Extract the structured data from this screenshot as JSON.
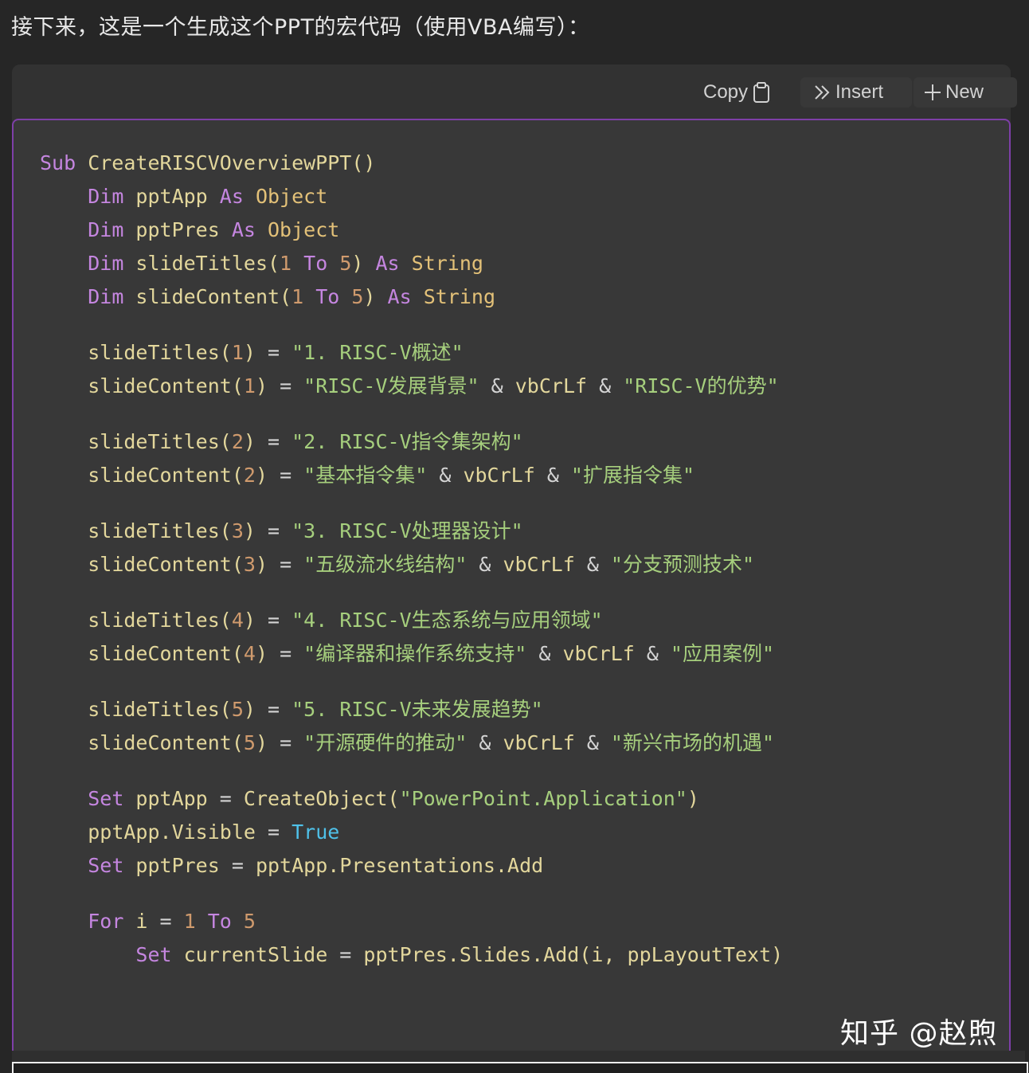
{
  "intro_text": "接下来，这是一个生成这个PPT的宏代码（使用VBA编写）：",
  "toolbar": {
    "copy_label": "Copy",
    "copy_icon": "clipboard-icon",
    "insert_label": "Insert",
    "insert_icon": "double-chevron-right-icon",
    "new_label": "New",
    "new_icon": "plus-icon"
  },
  "code": {
    "language": "VBA",
    "lines": [
      {
        "indent": "",
        "tokens": [
          [
            "kw",
            "Sub"
          ],
          [
            "id",
            " CreateRISCVOverviewPPT()"
          ]
        ]
      },
      {
        "indent": "    ",
        "tokens": [
          [
            "kw",
            "Dim"
          ],
          [
            "id",
            " pptApp "
          ],
          [
            "kw",
            "As"
          ],
          [
            "ty",
            " Object"
          ]
        ]
      },
      {
        "indent": "    ",
        "tokens": [
          [
            "kw",
            "Dim"
          ],
          [
            "id",
            " pptPres "
          ],
          [
            "kw",
            "As"
          ],
          [
            "ty",
            " Object"
          ]
        ]
      },
      {
        "indent": "    ",
        "tokens": [
          [
            "kw",
            "Dim"
          ],
          [
            "id",
            " slideTitles("
          ],
          [
            "num",
            "1"
          ],
          [
            "kw",
            " To"
          ],
          [
            "num",
            " 5"
          ],
          [
            "id",
            ") "
          ],
          [
            "kw",
            "As"
          ],
          [
            "ty",
            " String"
          ]
        ]
      },
      {
        "indent": "    ",
        "tokens": [
          [
            "kw",
            "Dim"
          ],
          [
            "id",
            " slideContent("
          ],
          [
            "num",
            "1"
          ],
          [
            "kw",
            " To"
          ],
          [
            "num",
            " 5"
          ],
          [
            "id",
            ") "
          ],
          [
            "kw",
            "As"
          ],
          [
            "ty",
            " String"
          ]
        ]
      },
      {
        "gap": true
      },
      {
        "indent": "    ",
        "tokens": [
          [
            "id",
            "slideTitles("
          ],
          [
            "num",
            "1"
          ],
          [
            "id",
            ") "
          ],
          [
            "op",
            "="
          ],
          [
            "str",
            " \"1. RISC-V概述\""
          ]
        ]
      },
      {
        "indent": "    ",
        "tokens": [
          [
            "id",
            "slideContent("
          ],
          [
            "num",
            "1"
          ],
          [
            "id",
            ") "
          ],
          [
            "op",
            "="
          ],
          [
            "str",
            " \"RISC-V发展背景\""
          ],
          [
            "op",
            " &"
          ],
          [
            "id",
            " vbCrLf "
          ],
          [
            "op",
            "&"
          ],
          [
            "str",
            " \"RISC-V的优势\""
          ]
        ]
      },
      {
        "gap": true
      },
      {
        "indent": "    ",
        "tokens": [
          [
            "id",
            "slideTitles("
          ],
          [
            "num",
            "2"
          ],
          [
            "id",
            ") "
          ],
          [
            "op",
            "="
          ],
          [
            "str",
            " \"2. RISC-V指令集架构\""
          ]
        ]
      },
      {
        "indent": "    ",
        "tokens": [
          [
            "id",
            "slideContent("
          ],
          [
            "num",
            "2"
          ],
          [
            "id",
            ") "
          ],
          [
            "op",
            "="
          ],
          [
            "str",
            " \"基本指令集\""
          ],
          [
            "op",
            " &"
          ],
          [
            "id",
            " vbCrLf "
          ],
          [
            "op",
            "&"
          ],
          [
            "str",
            " \"扩展指令集\""
          ]
        ]
      },
      {
        "gap": true
      },
      {
        "indent": "    ",
        "tokens": [
          [
            "id",
            "slideTitles("
          ],
          [
            "num",
            "3"
          ],
          [
            "id",
            ") "
          ],
          [
            "op",
            "="
          ],
          [
            "str",
            " \"3. RISC-V处理器设计\""
          ]
        ]
      },
      {
        "indent": "    ",
        "tokens": [
          [
            "id",
            "slideContent("
          ],
          [
            "num",
            "3"
          ],
          [
            "id",
            ") "
          ],
          [
            "op",
            "="
          ],
          [
            "str",
            " \"五级流水线结构\""
          ],
          [
            "op",
            " &"
          ],
          [
            "id",
            " vbCrLf "
          ],
          [
            "op",
            "&"
          ],
          [
            "str",
            " \"分支预测技术\""
          ]
        ]
      },
      {
        "gap": true
      },
      {
        "indent": "    ",
        "tokens": [
          [
            "id",
            "slideTitles("
          ],
          [
            "num",
            "4"
          ],
          [
            "id",
            ") "
          ],
          [
            "op",
            "="
          ],
          [
            "str",
            " \"4. RISC-V生态系统与应用领域\""
          ]
        ]
      },
      {
        "indent": "    ",
        "tokens": [
          [
            "id",
            "slideContent("
          ],
          [
            "num",
            "4"
          ],
          [
            "id",
            ") "
          ],
          [
            "op",
            "="
          ],
          [
            "str",
            " \"编译器和操作系统支持\""
          ],
          [
            "op",
            " &"
          ],
          [
            "id",
            " vbCrLf "
          ],
          [
            "op",
            "&"
          ],
          [
            "str",
            " \"应用案例\""
          ]
        ]
      },
      {
        "gap": true
      },
      {
        "indent": "    ",
        "tokens": [
          [
            "id",
            "slideTitles("
          ],
          [
            "num",
            "5"
          ],
          [
            "id",
            ") "
          ],
          [
            "op",
            "="
          ],
          [
            "str",
            " \"5. RISC-V未来发展趋势\""
          ]
        ]
      },
      {
        "indent": "    ",
        "tokens": [
          [
            "id",
            "slideContent("
          ],
          [
            "num",
            "5"
          ],
          [
            "id",
            ") "
          ],
          [
            "op",
            "="
          ],
          [
            "str",
            " \"开源硬件的推动\""
          ],
          [
            "op",
            " &"
          ],
          [
            "id",
            " vbCrLf "
          ],
          [
            "op",
            "&"
          ],
          [
            "str",
            " \"新兴市场的机遇\""
          ]
        ]
      },
      {
        "gap": true
      },
      {
        "indent": "    ",
        "tokens": [
          [
            "kw",
            "Set"
          ],
          [
            "id",
            " pptApp "
          ],
          [
            "op",
            "="
          ],
          [
            "id",
            " CreateObject("
          ],
          [
            "str",
            "\"PowerPoint.Application\""
          ],
          [
            "id",
            ")"
          ]
        ]
      },
      {
        "indent": "    ",
        "tokens": [
          [
            "id",
            "pptApp.Visible "
          ],
          [
            "op",
            "="
          ],
          [
            "bool",
            " True"
          ]
        ]
      },
      {
        "indent": "    ",
        "tokens": [
          [
            "kw",
            "Set"
          ],
          [
            "id",
            " pptPres "
          ],
          [
            "op",
            "="
          ],
          [
            "id",
            " pptApp.Presentations.Add"
          ]
        ]
      },
      {
        "gap": true
      },
      {
        "indent": "    ",
        "tokens": [
          [
            "kw",
            "For"
          ],
          [
            "id",
            " i "
          ],
          [
            "op",
            "="
          ],
          [
            "num",
            " 1"
          ],
          [
            "kw",
            " To"
          ],
          [
            "num",
            " 5"
          ]
        ]
      },
      {
        "indent": "        ",
        "tokens": [
          [
            "kw",
            "Set"
          ],
          [
            "id",
            " currentSlide "
          ],
          [
            "op",
            "="
          ],
          [
            "id",
            " pptPres.Slides.Add(i, ppLayoutText)"
          ]
        ]
      }
    ]
  },
  "watermark": "知乎 @赵煦",
  "colors": {
    "background": "#262626",
    "card": "#323232",
    "code_background": "#383838",
    "code_border": "#7e3fa8",
    "keyword": "#c586e0",
    "string": "#a6cf7d",
    "number": "#cf9a6d",
    "boolean": "#4fc1e9"
  }
}
